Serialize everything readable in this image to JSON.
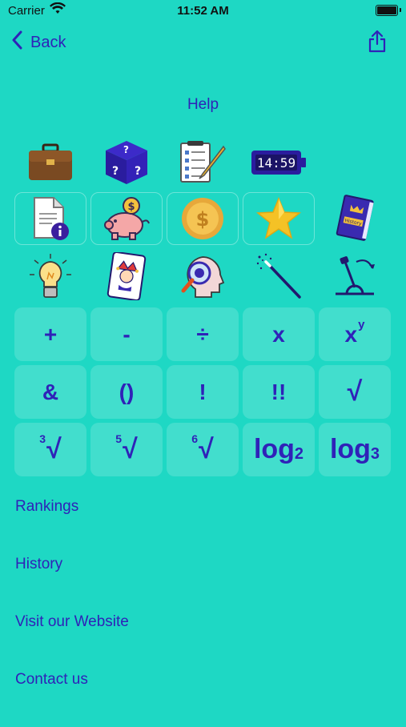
{
  "status_bar": {
    "carrier": "Carrier",
    "time": "11:52 AM"
  },
  "nav": {
    "back_label": "Back"
  },
  "page": {
    "title": "Help"
  },
  "icons": {
    "row1": [
      "briefcase-icon",
      "mystery-box-icon",
      "checklist-icon",
      "digital-clock-icon"
    ],
    "row2": [
      "document-info-icon",
      "piggy-bank-icon",
      "gold-coin-icon",
      "gold-star-icon",
      "history-book-icon"
    ],
    "row3": [
      "lightbulb-icon",
      "joker-card-icon",
      "magnifier-head-icon",
      "magic-wand-icon",
      "lever-icon"
    ],
    "clock_display": "14:59",
    "book_label": "History"
  },
  "keys": {
    "plus": "+",
    "minus": "-",
    "divide": "÷",
    "times": "x",
    "power_base": "x",
    "power_exp": "y",
    "ampersand": "&",
    "parens": "()",
    "factorial": "!",
    "double_factorial": "!!",
    "sqrt": "√",
    "cbrt_index": "3",
    "cbrt_sign": "√",
    "root5_index": "5",
    "root5_sign": "√",
    "root6_index": "6",
    "root6_sign": "√",
    "log2_base": "log",
    "log2_sub": "2",
    "log3_base": "log",
    "log3_sub": "3"
  },
  "links": {
    "rankings": "Rankings",
    "history": "History",
    "website": "Visit our Website",
    "contact": "Contact us"
  },
  "colors": {
    "background": "#1ed8c4",
    "accent": "#2f22b8"
  }
}
